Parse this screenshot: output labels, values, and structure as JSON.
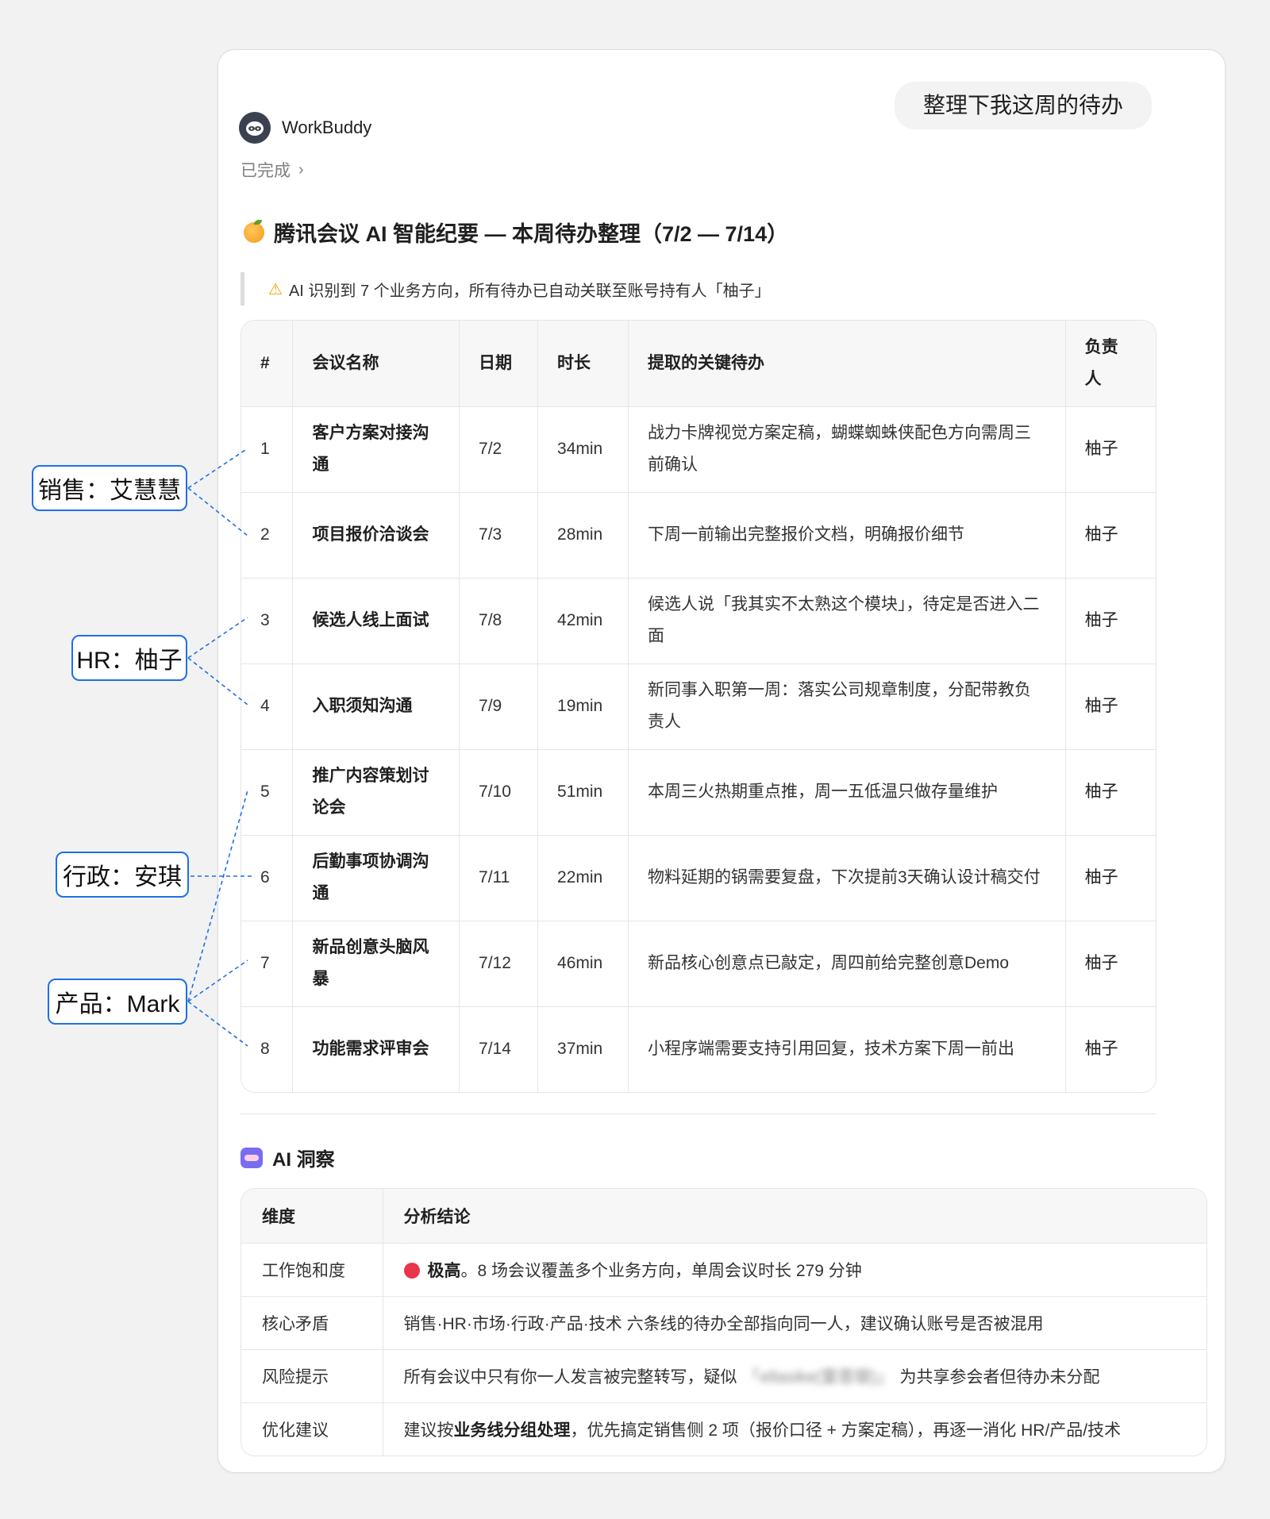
{
  "chat": {
    "user_message": "整理下我这周的待办",
    "assistant_name": "WorkBuddy",
    "status": "已完成",
    "status_chevron": "›"
  },
  "report": {
    "title": "腾讯会议 AI 智能纪要 — 本周待办整理（7/2 — 7/14）",
    "note": "AI 识别到 7 个业务方向，所有待办已自动关联至账号持有人「柚子」",
    "headers": {
      "num": "#",
      "name": "会议名称",
      "date": "日期",
      "duration": "时长",
      "todo": "提取的关键待办",
      "owner_line1": "负责",
      "owner_line2": "人"
    },
    "rows": [
      {
        "num": "1",
        "name": "客户方案对接沟通",
        "date": "7/2",
        "duration": "34min",
        "todo": "战力卡牌视觉方案定稿，蝴蝶蜘蛛侠配色方向需周三前确认",
        "owner": "柚子"
      },
      {
        "num": "2",
        "name": "项目报价洽谈会",
        "date": "7/3",
        "duration": "28min",
        "todo": "下周一前输出完整报价文档，明确报价细节",
        "owner": "柚子"
      },
      {
        "num": "3",
        "name": "候选人线上面试",
        "date": "7/8",
        "duration": "42min",
        "todo": "候选人说「我其实不太熟这个模块」，待定是否进入二面",
        "owner": "柚子"
      },
      {
        "num": "4",
        "name": "入职须知沟通",
        "date": "7/9",
        "duration": "19min",
        "todo": "新同事入职第一周：落实公司规章制度，分配带教负责人",
        "owner": "柚子"
      },
      {
        "num": "5",
        "name": "推广内容策划讨论会",
        "date": "7/10",
        "duration": "51min",
        "todo": "本周三火热期重点推，周一五低温只做存量维护",
        "owner": "柚子"
      },
      {
        "num": "6",
        "name": "后勤事项协调沟通",
        "date": "7/11",
        "duration": "22min",
        "todo": "物料延期的锅需要复盘，下次提前3天确认设计稿交付",
        "owner": "柚子"
      },
      {
        "num": "7",
        "name": "新品创意头脑风暴",
        "date": "7/12",
        "duration": "46min",
        "todo": "新品核心创意点已敲定，周四前给完整创意Demo",
        "owner": "柚子"
      },
      {
        "num": "8",
        "name": "功能需求评审会",
        "date": "7/14",
        "duration": "37min",
        "todo": "小程序端需要支持引用回复，技术方案下周一前出",
        "owner": "柚子"
      }
    ]
  },
  "insights": {
    "title": "AI 洞察",
    "headers": {
      "dimension": "维度",
      "conclusion": "分析结论"
    },
    "rows": [
      {
        "dimension": "工作饱和度",
        "bold": "极高",
        "text": "。8 场会议覆盖多个业务方向，单周会议时长 279 分钟"
      },
      {
        "dimension": "核心矛盾",
        "text": "销售·HR·市场·行政·产品·技术 六条线的待办全部指向同一人，建议确认账号是否被混用"
      },
      {
        "dimension": "风险提示",
        "text_before": "所有会议中只有你一人发言被完整转写，疑似",
        "blurred": "「ellasike(雷恩银)」",
        "text_after": "为共享参会者但待办未分配"
      },
      {
        "dimension": "优化建议",
        "text_before": "建议按",
        "bold": "业务线分组处理",
        "text_after": "，优先搞定销售侧 2 项（报价口径 + 方案定稿），再逐一消化 HR/产品/技术"
      }
    ]
  },
  "callouts": [
    {
      "label": "销售：艾慧慧"
    },
    {
      "label": "HR：柚子"
    },
    {
      "label": "行政：安琪"
    },
    {
      "label": "产品：Mark"
    }
  ],
  "colors": {
    "callout_border": "#1e6fe8",
    "status_dot": "#e8344d",
    "warning": "#f0a400"
  },
  "icons": [
    "orange-icon",
    "warning-icon",
    "robot-icon",
    "chevron-right-icon",
    "avatar-icon"
  ]
}
